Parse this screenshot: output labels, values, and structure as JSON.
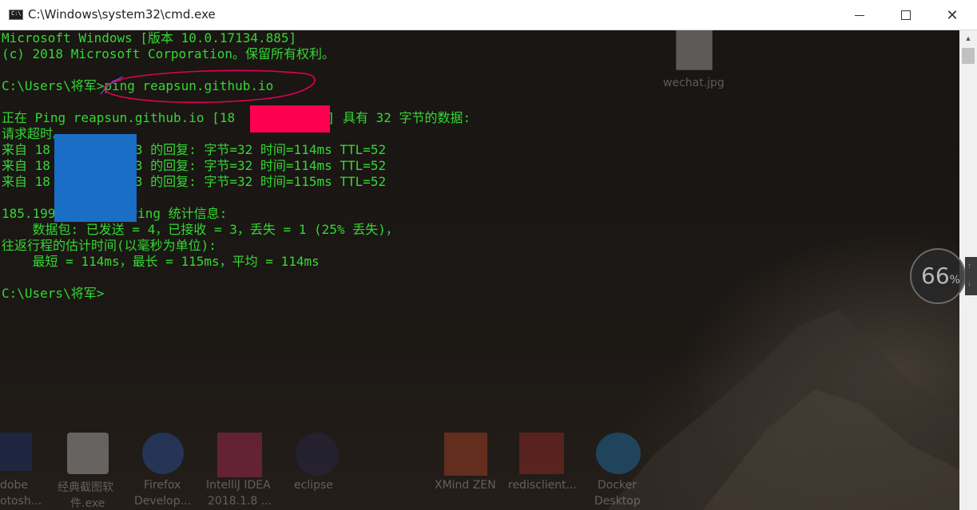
{
  "window": {
    "title": "C:\\Windows\\system32\\cmd.exe",
    "icon_text": "C:\\",
    "close_glyph": "✕"
  },
  "console": {
    "lines": [
      "Microsoft Windows [版本 10.0.17134.885]",
      "(c) 2018 Microsoft Corporation。保留所有权利。",
      "",
      "C:\\Users\\将军>ping reapsun.github.io",
      "",
      "正在 Ping reapsun.github.io [18         153] 具有 32 字节的数据:",
      "请求超时。",
      "来自 18         153 的回复: 字节=32 时间=114ms TTL=52",
      "来自 18         153 的回复: 字节=32 时间=114ms TTL=52",
      "来自 18         153 的回复: 字节=32 时间=115ms TTL=52",
      "",
      "185.199       的 Ping 统计信息:",
      "    数据包: 已发送 = 4，已接收 = 3，丢失 = 1 (25% 丢失)，",
      "往返行程的估计时间(以毫秒为单位):",
      "    最短 = 114ms，最长 = 115ms，平均 = 114ms",
      "",
      "C:\\Users\\将军>"
    ]
  },
  "desktop": {
    "icons": [
      {
        "label": "wechat.jpg"
      },
      {
        "label": "dobe"
      },
      {
        "label": "otosh..."
      },
      {
        "label": "经典截图软"
      },
      {
        "label": "件.exe"
      },
      {
        "label": "Firefox"
      },
      {
        "label": "Develop..."
      },
      {
        "label": "IntelliJ IDEA"
      },
      {
        "label": "2018.1.8 ..."
      },
      {
        "label": "eclipse"
      },
      {
        "label": "XMind ZEN"
      },
      {
        "label": "redisclient..."
      },
      {
        "label": "Docker"
      },
      {
        "label": "Desktop"
      }
    ]
  },
  "widget": {
    "value": "66",
    "unit": "%",
    "up_arrow": "↑",
    "down_arrow": "↓"
  },
  "colors": {
    "console_text": "#33d833",
    "redaction_red": "#ff0050",
    "redaction_blue": "#1a6ec6",
    "annotation": "#e0005a"
  }
}
